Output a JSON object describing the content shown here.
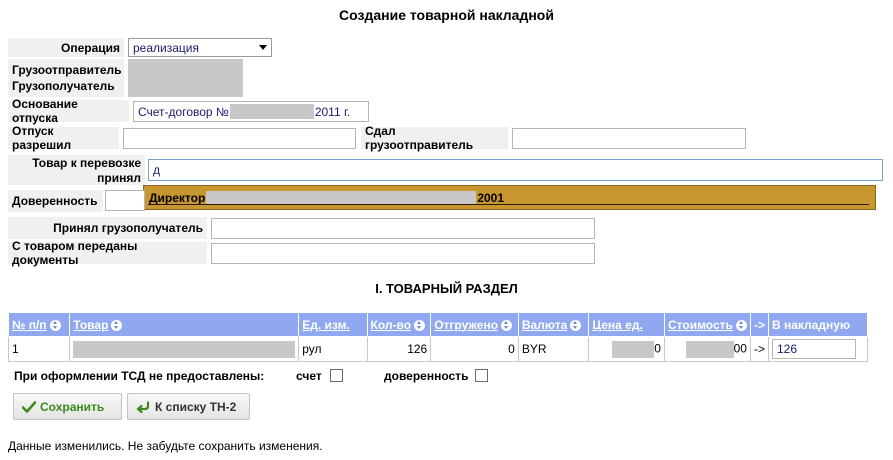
{
  "page_title": "Создание товарной накладной",
  "form": {
    "operation_label": "Операция",
    "operation_value": "реализация",
    "shipper_label": "Грузоотправитель",
    "consignee_label": "Грузополучатель",
    "basis_label": "Основание отпуска",
    "basis_value_prefix": "Счет-договор №",
    "basis_value_suffix": "2011 г.",
    "release_label": "Отпуск разрешил",
    "release_value": "",
    "handed_by_label": "Сдал грузоотправитель",
    "handed_by_value": "",
    "goods_accepted_label_line1": "Товар к перевозке",
    "goods_accepted_label_line2": "принял",
    "goods_accepted_value": "д",
    "autocomplete_prefix": "Директор",
    "autocomplete_suffix": "2001",
    "proxy_label": "Доверенность",
    "received_label": "Принял грузополучатель",
    "received_value": "",
    "documents_label": "С товаром переданы документы",
    "documents_value": ""
  },
  "section_title": "I. ТОВАРНЫЙ РАЗДЕЛ",
  "table": {
    "headers": {
      "num": "№ п/п",
      "goods": "Товар",
      "unit": "Ед. изм.",
      "qty": "Кол-во",
      "shipped": "Отгружено",
      "currency": "Валюта",
      "price": "Цена ед.",
      "cost": "Стоимость",
      "arrow": "->",
      "to_invoice": "В накладную"
    },
    "rows": [
      {
        "num": "1",
        "unit": "рул",
        "qty": "126",
        "shipped": "0",
        "currency": "BYR",
        "price_suffix": "0",
        "cost_suffix": "00",
        "arrow": "->",
        "to_invoice": "126"
      }
    ]
  },
  "not_provided_label": "При оформлении ТСД не предоставлены:",
  "invoice_check_label": "счет",
  "proxy_check_label": "доверенность",
  "buttons": {
    "save": "Сохранить",
    "to_list": "К списку ТН-2"
  },
  "status_message": "Данные изменились. Не забудьте сохранить изменения.",
  "colors": {
    "header_bg": "#8fa8f0",
    "dropdown_bg": "#c8962e",
    "save_text": "#3d8a1e"
  }
}
